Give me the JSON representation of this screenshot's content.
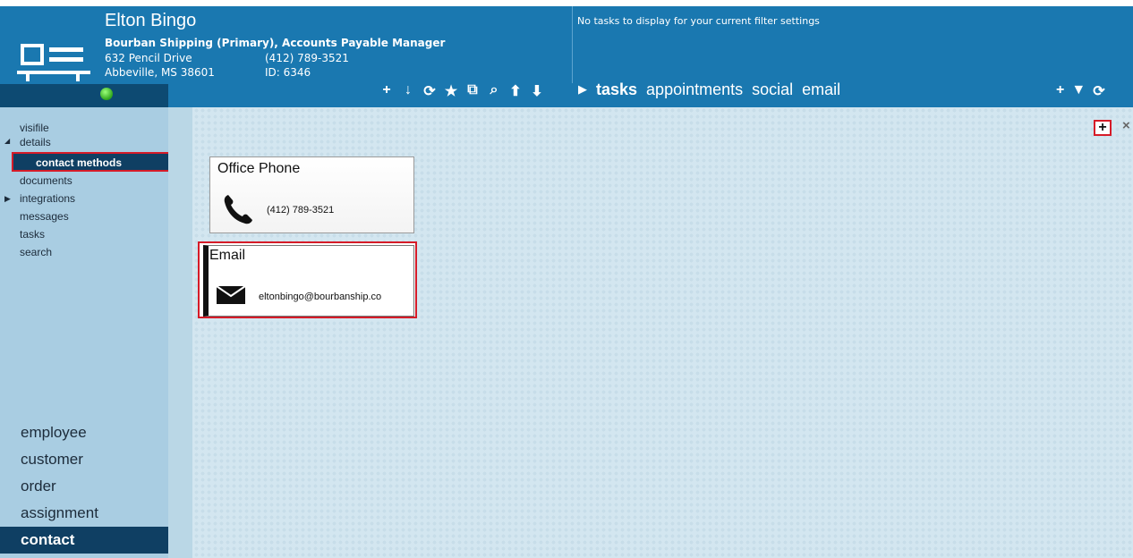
{
  "header": {
    "name": "Elton Bingo",
    "company": "Bourban Shipping  (Primary), Accounts Payable Manager",
    "address_line1": "632 Pencil Drive",
    "address_line2": "Abbeville, MS   38601",
    "phone": "(412) 789-3521",
    "id": "ID:  6346",
    "status_color": "#2fa51c"
  },
  "tasks_panel": {
    "message": "No tasks to display for your current filter settings",
    "tabs": [
      "tasks",
      "appointments",
      "social",
      "email"
    ]
  },
  "toolbar": {
    "icons": [
      "plus-icon",
      "down-arrow-icon",
      "refresh-icon",
      "star-icon",
      "external-icon",
      "search-icon",
      "up-icon",
      "down-icon"
    ],
    "glyphs": [
      "+",
      "↓",
      "⟳",
      "★",
      "⧉",
      "⌕",
      "⬆",
      "⬇"
    ]
  },
  "right_toolbar": {
    "glyphs": [
      "+",
      "▼",
      "⟳"
    ]
  },
  "sidebar": {
    "items": [
      "visifile",
      "details",
      "contact methods",
      "documents",
      "integrations",
      "messages",
      "tasks",
      "search"
    ],
    "active": "contact methods"
  },
  "bottom_nav": [
    "employee",
    "customer",
    "order",
    "assignment",
    "contact"
  ],
  "contact_methods": [
    {
      "title": "Office Phone",
      "value": "(412) 789-3521",
      "icon": "phone-icon"
    },
    {
      "title": "Email",
      "value": "eltonbingo@bourbanship.co",
      "icon": "envelope-icon"
    }
  ],
  "actions": {
    "add": "+",
    "close": "×"
  },
  "colors": {
    "header": "#1a78b0",
    "nav_dark": "#0f3f63",
    "sidebar": "#a9cde2",
    "highlight": "#d61b28"
  }
}
